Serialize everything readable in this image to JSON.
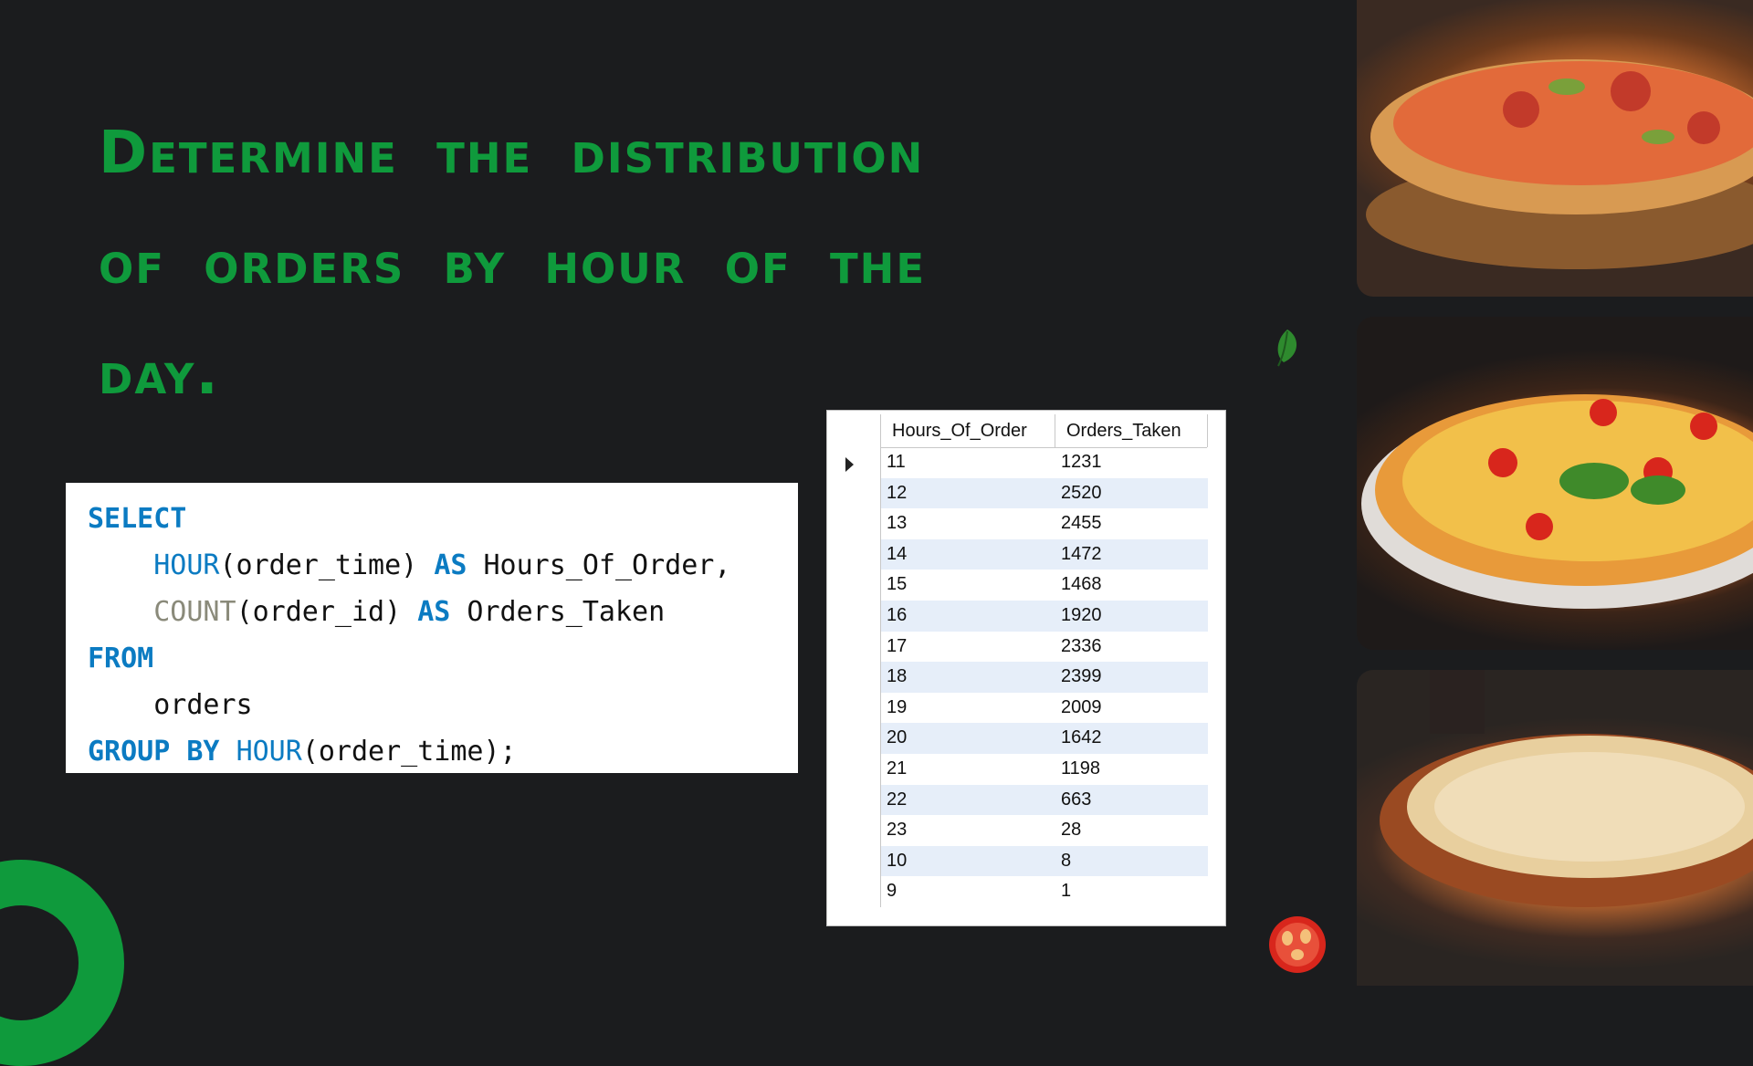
{
  "title": "Determine the distribution of orders by hour of the day.",
  "code": {
    "l1_kw": "SELECT",
    "l2_fn": "HOUR",
    "l2_args": "(order_time) ",
    "l2_kw": "AS",
    "l2_alias": " Hours_Of_Order,",
    "l3_fn": "COUNT",
    "l3_args": "(order_id) ",
    "l3_kw": "AS",
    "l3_alias": " Orders_Taken",
    "l4_kw": "FROM",
    "l5_table": "orders",
    "l6_kw": "GROUP BY",
    "l6_fn": "HOUR",
    "l6_args": "(order_time);"
  },
  "grid": {
    "columns": [
      "Hours_Of_Order",
      "Orders_Taken"
    ],
    "rows": [
      [
        "11",
        "1231"
      ],
      [
        "12",
        "2520"
      ],
      [
        "13",
        "2455"
      ],
      [
        "14",
        "1472"
      ],
      [
        "15",
        "1468"
      ],
      [
        "16",
        "1920"
      ],
      [
        "17",
        "2336"
      ],
      [
        "18",
        "2399"
      ],
      [
        "19",
        "2009"
      ],
      [
        "20",
        "1642"
      ],
      [
        "21",
        "1198"
      ],
      [
        "22",
        "663"
      ],
      [
        "23",
        "28"
      ],
      [
        "10",
        "8"
      ],
      [
        "9",
        "1"
      ]
    ]
  },
  "colors": {
    "accent": "#0f9a3c",
    "background": "#1b1c1e",
    "keyword": "#0b7bc2"
  },
  "images": [
    "pizza-photo-1",
    "pizza-photo-2",
    "pizza-photo-3"
  ],
  "decor": [
    "basil-leaf-icon",
    "tomato-slice-icon",
    "green-arc"
  ]
}
